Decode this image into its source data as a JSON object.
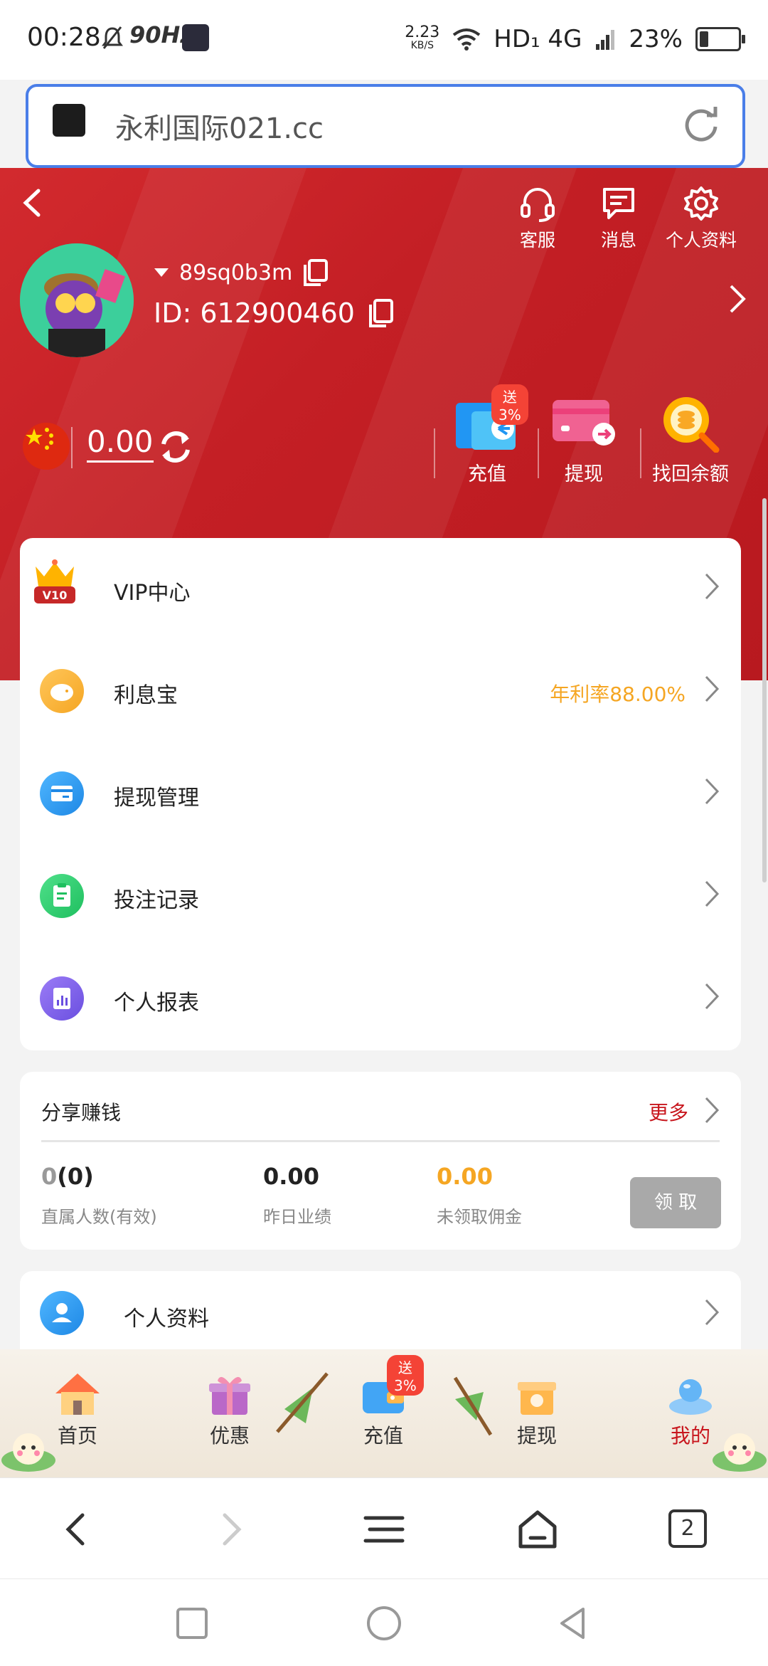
{
  "status_bar": {
    "time": "00:28",
    "refresh_rate": "90Hz",
    "net_speed_value": "2.23",
    "net_speed_unit": "KB/S",
    "network": "HD₁ 4G",
    "battery": "23%"
  },
  "url_bar": {
    "url": "永利国际021.cc"
  },
  "header": {
    "actions": [
      {
        "label": "客服",
        "icon": "headset-icon"
      },
      {
        "label": "消息",
        "icon": "message-icon"
      },
      {
        "label": "个人资料",
        "icon": "gear-icon"
      }
    ],
    "username": "89sq0b3m",
    "user_id": "ID: 612900460",
    "balance": "0.00",
    "fund_actions": [
      {
        "label": "充值",
        "icon": "wallet-icon",
        "badge": "送3%"
      },
      {
        "label": "提现",
        "icon": "card-icon"
      },
      {
        "label": "找回余额",
        "icon": "coin-search-icon"
      }
    ]
  },
  "menu": {
    "items": [
      {
        "label": "VIP中心",
        "icon": "crown-icon",
        "extra": ""
      },
      {
        "label": "利息宝",
        "icon": "piggy-bank-icon",
        "extra": "年利率88.00%"
      },
      {
        "label": "提现管理",
        "icon": "withdraw-card-icon",
        "extra": ""
      },
      {
        "label": "投注记录",
        "icon": "clipboard-icon",
        "extra": ""
      },
      {
        "label": "个人报表",
        "icon": "report-icon",
        "extra": ""
      }
    ]
  },
  "share": {
    "title": "分享赚钱",
    "more": "更多",
    "stats": [
      {
        "value_gray": "0",
        "value": "(0)",
        "label": "直属人数(有效)"
      },
      {
        "value_gray": "",
        "value": "0.00",
        "label": "昨日业绩"
      },
      {
        "value_gray": "",
        "value": "0.00",
        "label": "未领取佣金"
      }
    ],
    "claim_label": "领 取"
  },
  "profile_row": {
    "label": "个人资料"
  },
  "bottom_nav": {
    "items": [
      {
        "label": "首页",
        "icon": "house-icon",
        "active": false
      },
      {
        "label": "优惠",
        "icon": "gift-icon",
        "active": false
      },
      {
        "label": "充值",
        "icon": "recharge-wallet-icon",
        "active": false,
        "badge": "送3%"
      },
      {
        "label": "提现",
        "icon": "withdraw-gift-icon",
        "active": false
      },
      {
        "label": "我的",
        "icon": "user-bubble-icon",
        "active": true
      }
    ],
    "active_color": "#c8161d"
  },
  "browser_bar": {
    "tab_count": "2"
  },
  "colors": {
    "header_red": "#c41f25",
    "accent_orange": "#f5a623",
    "url_border": "#4a7ee8"
  }
}
